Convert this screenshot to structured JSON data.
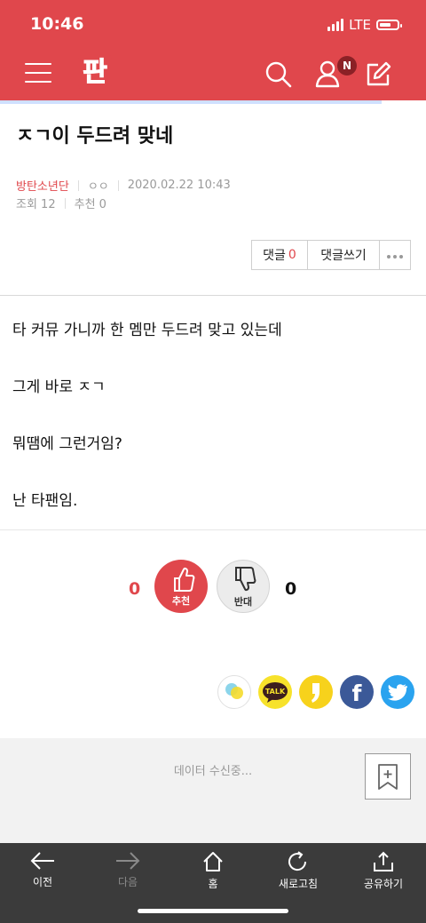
{
  "status": {
    "time": "10:46",
    "network": "LTE"
  },
  "header": {
    "logo_text": "판",
    "notification_badge": "N",
    "accent_color": "#e0474c"
  },
  "post": {
    "title": "ㅈㄱ이 두드려 맞네",
    "category": "방탄소년단",
    "author": "ㅇㅇ",
    "datetime": "2020.02.22 10:43",
    "views": "조회 12",
    "recommends": "추천 0"
  },
  "actions": {
    "comment_label": "댓글",
    "comment_count": "0",
    "write_comment_label": "댓글쓰기"
  },
  "body": {
    "paragraphs": [
      "타 커뮤 가니까 한 멤만 두드려 맞고 있는데",
      "그게 바로 ㅈㄱ",
      "뭐땜에 그런거임?",
      "난 타팬임."
    ]
  },
  "votes": {
    "up_count": "0",
    "up_label": "추천",
    "down_label": "반대",
    "down_count": "0"
  },
  "share": {
    "icons": [
      "share-more-icon",
      "kakaotalk-icon",
      "kakaostory-icon",
      "facebook-icon",
      "twitter-icon"
    ],
    "talk_text": "TALK",
    "fb_text": "f"
  },
  "loading": {
    "text": "데이터 수신중..."
  },
  "nav": {
    "back": "이전",
    "next": "다음",
    "home": "홈",
    "refresh": "새로고침",
    "share": "공유하기"
  }
}
